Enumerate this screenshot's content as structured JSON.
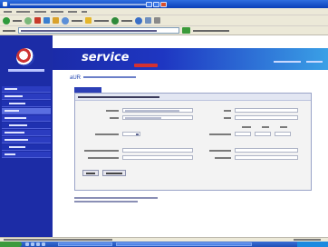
{
  "header": {
    "brand_prefix": "",
    "brand_name": "service"
  },
  "breadcrumb": {
    "current": "aUR"
  },
  "colors": {
    "nav_background": "#1c2ca6",
    "header_gradient_start": "#1b2ba8",
    "header_gradient_end": "#3aa0e6",
    "accent_red": "#d43131",
    "breadcrumb_link": "#1a3fae",
    "window_chrome": "#ece9d8",
    "taskbar": "#1f4fb5"
  },
  "icons": {
    "browser_toolbar": [
      "back-icon",
      "forward-icon",
      "stop-icon",
      "refresh-icon",
      "home-icon",
      "search-icon",
      "favorites-icon",
      "media-icon",
      "history-icon",
      "mail-icon",
      "print-icon"
    ],
    "logo": "service-logo-icon"
  }
}
